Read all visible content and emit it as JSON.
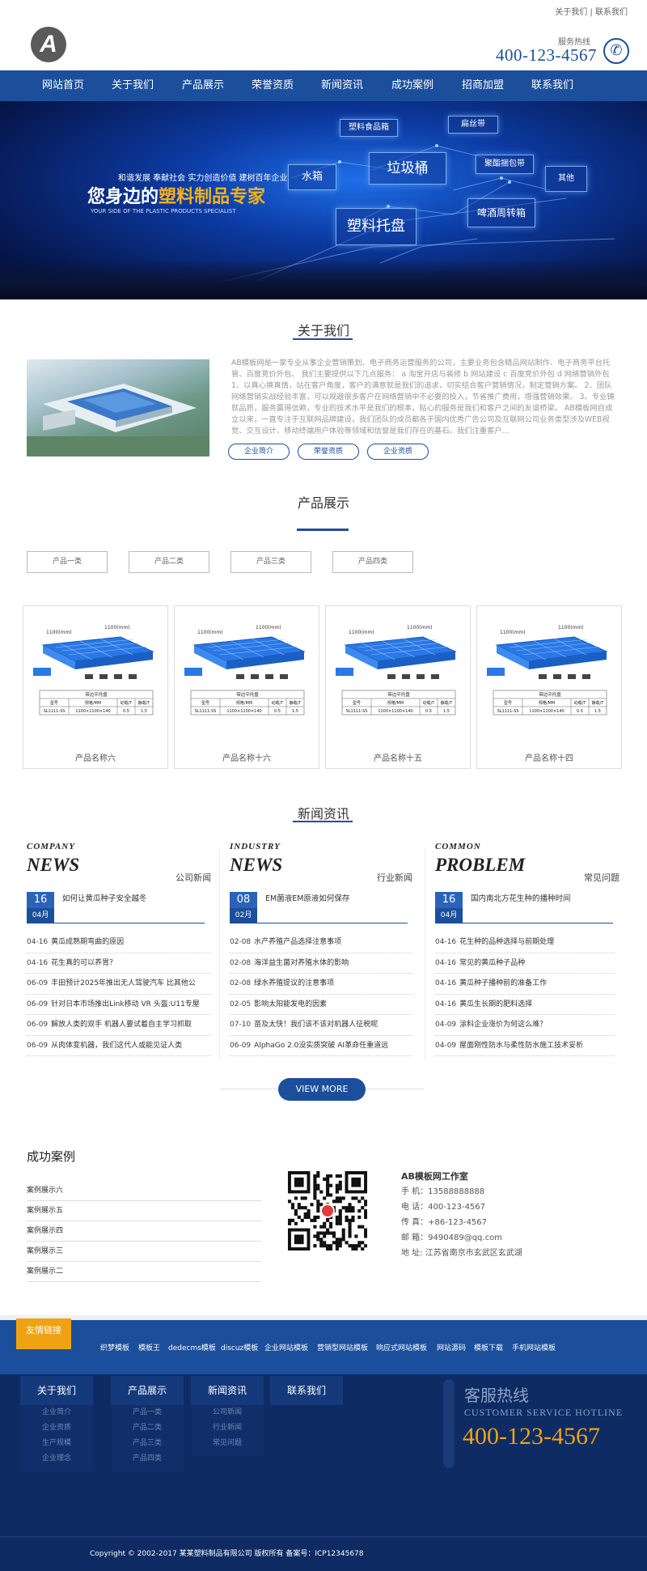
{
  "header": {
    "top_links": "关于我们 | 联系我们",
    "logo_letter": "A",
    "hotline_label": "服务热线",
    "hotline_number": "400-123-4567"
  },
  "nav": {
    "items": [
      "网站首页",
      "关于我们",
      "产品展示",
      "荣誉资质",
      "新闻资讯",
      "成功案例",
      "招商加盟",
      "联系我们"
    ]
  },
  "banner": {
    "subtitle": "和谐发展 奉献社会 实力创造价值 建树百年企业",
    "title_prefix": "您身边的",
    "title_highlight": "塑料制品专家",
    "title_en": "YOUR SIDE OF THE PLASTIC PRODUCTS SPECIALIST",
    "tags": [
      "塑料食品箱",
      "扁丝带",
      "水箱",
      "垃圾桶",
      "聚酯捆包带",
      "其他",
      "啤酒周转箱",
      "塑料托盘"
    ]
  },
  "about": {
    "title": "关于我们",
    "text": "AB模板网是一家专业从事企业营销策划、电子商务运营服务的公司，主要业务包含精品网站制作、电子商务平台托管、百度竞价外包、 我们主要提供以下几点服务： a 淘宝开店与装修 b 网站建设 c 百度竞价外包 d 网络营销外包 1、以真心换真情，站在客户角度，客户的满意就是我们的追求，切实结合客户营销情况，制定营销方案。 2、团队网络营销实战经验丰富，可以规避很多客户在网络营销中不必要的投入，节省推广费用，增强营销效果。 3、专业铸就品质，服务赢得信赖，专业的技术水平是我们的根本，贴心的服务是我们和客户之间的友谊桥梁。 AB模板网自成立以来，一直专注于互联网品牌建设，我们团队的成员都各于国内优秀广告公司及互联网公司业务类型涉及WEB视觉、交互设计、移动终端用户体验等领域和信誉是我们存在的基石。我们注重客户...",
    "buttons": [
      "企业简介",
      "荣誉资质",
      "企业资质"
    ]
  },
  "products": {
    "title": "产品展示",
    "tabs": [
      "产品一类",
      "产品二类",
      "产品三类",
      "产品四类"
    ],
    "items": [
      {
        "name": "产品名称六",
        "table_title": "带边平托盘",
        "model": "SL1111-SS",
        "spec": "1100×1100×140",
        "dyn": "0.5",
        "sta": "1.5"
      },
      {
        "name": "产品名称十六",
        "table_title": "带边平托盘",
        "model": "SL1111-SS",
        "spec": "1100×1100×140",
        "dyn": "0.5",
        "sta": "1.5"
      },
      {
        "name": "产品名称十五",
        "table_title": "带边平托盘",
        "model": "SL1111-SS",
        "spec": "1100×1100×140",
        "dyn": "0.5",
        "sta": "1.5"
      },
      {
        "name": "产品名称十四",
        "table_title": "带边平托盘",
        "model": "SL1111-SS",
        "spec": "1100×1100×140",
        "dyn": "0.5",
        "sta": "1.5"
      }
    ],
    "dimension_label": "1100(mm)",
    "table_headers": [
      "型号",
      "规格/MM",
      "动载/T",
      "静载/T"
    ]
  },
  "news": {
    "title": "新闻资讯",
    "columns": [
      {
        "en_top": "COMPANY",
        "en_big": "NEWS",
        "cn": "公司新闻",
        "feature": {
          "day": "16",
          "month": "04月",
          "title": "如何让黄瓜种子安全越冬"
        },
        "rows": [
          {
            "date": "04-16",
            "title": "黄瓜成熟期弯曲的原因"
          },
          {
            "date": "04-16",
            "title": "花生真的可以养胃？"
          },
          {
            "date": "06-09",
            "title": "丰田预计2025年推出无人驾驶汽车 比其他公"
          },
          {
            "date": "06-09",
            "title": "针对日本市场推出Link移动 VR 头盔:U11专屋"
          },
          {
            "date": "06-09",
            "title": "解放人类的双手 机器人要试着自主学习抓取"
          },
          {
            "date": "06-09",
            "title": "从肉体变机器，我们这代人或能见证人类"
          }
        ]
      },
      {
        "en_top": "INDUSTRY",
        "en_big": "NEWS",
        "cn": "行业新闻",
        "feature": {
          "day": "08",
          "month": "02月",
          "title": "EM菌液EM原液如何保存"
        },
        "rows": [
          {
            "date": "02-08",
            "title": "水产养殖产品选择注意事项"
          },
          {
            "date": "02-08",
            "title": "海洋益生菌对养殖水体的影响"
          },
          {
            "date": "02-08",
            "title": "绿水养殖提议的注意事项"
          },
          {
            "date": "02-05",
            "title": "影响太阳能发电的因素"
          },
          {
            "date": "07-10",
            "title": "苗及太快！我们该不该对机器人征税呢"
          },
          {
            "date": "06-09",
            "title": "AlphaGo 2.0没实质突破 AI革命任重道远"
          }
        ]
      },
      {
        "en_top": "COMMON",
        "en_big": "PROBLEM",
        "cn": "常见问题",
        "feature": {
          "day": "16",
          "month": "04月",
          "title": "国内南北方花生种的播种时间"
        },
        "rows": [
          {
            "date": "04-16",
            "title": "花生种的品种选择与前期处理"
          },
          {
            "date": "04-16",
            "title": "常见的黄瓜种子品种"
          },
          {
            "date": "04-16",
            "title": "黄瓜种子播种前的准备工作"
          },
          {
            "date": "04-16",
            "title": "黄瓜生长期的肥料选择"
          },
          {
            "date": "04-09",
            "title": "涂料企业涨价为何这么难？"
          },
          {
            "date": "04-09",
            "title": "屋面刚性防水与柔性防水施工技术妥析"
          }
        ]
      }
    ],
    "more_label": "VIEW MORE"
  },
  "cases": {
    "title": "成功案例",
    "items": [
      "案例展示六",
      "案例展示五",
      "案例展示四",
      "案例展示三",
      "案例展示二"
    ]
  },
  "contact": {
    "name": "AB模板网工作室",
    "lines": [
      "手 机：13588888888",
      "电 话：400-123-4567",
      "传 真：+86-123-4567",
      "邮 箱：9490489@qq.com",
      "地 址: 江苏省南京市玄武区玄武湖"
    ]
  },
  "friend_links": {
    "label": "友情链接",
    "items": [
      "织梦模板",
      "模板王",
      "dedecms模板",
      "discuz模板",
      "企业网站模板",
      "营销型网站模板",
      "响应式网站模板",
      "网站源码",
      "模板下载",
      "手机网站模板"
    ]
  },
  "footer": {
    "columns": [
      {
        "title": "关于我们",
        "items": [
          "企业简介",
          "企业资质",
          "生产规模",
          "企业理念"
        ]
      },
      {
        "title": "产品展示",
        "items": [
          "产品一类",
          "产品二类",
          "产品三类",
          "产品四类"
        ]
      },
      {
        "title": "新闻资讯",
        "items": [
          "公司新闻",
          "行业新闻",
          "常见问题"
        ]
      },
      {
        "title": "联系我们",
        "items": []
      }
    ],
    "hotline_cn": "客服热线",
    "hotline_en": "CUSTOMER SERVICE HOTLINE",
    "hotline_number": "400-123-4567",
    "copyright": "Copyright © 2002-2017 某某塑料制品有限公司 版权所有 备案号：ICP12345678"
  },
  "colors": {
    "brand": "#1b4f9c",
    "accent": "#f0a312",
    "footer_bg": "#0e2b63"
  }
}
